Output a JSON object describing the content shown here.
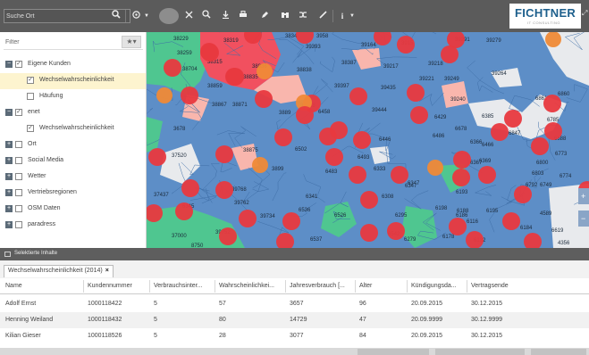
{
  "toolbar": {
    "search_placeholder": "Suche Ort",
    "buttons": [
      "search-icon",
      "globe-icon",
      "caret-icon",
      "fullscreen-icon",
      "zoom-icon",
      "download-icon",
      "print-icon",
      "pencil-icon",
      "binoculars-icon",
      "shuffle-icon",
      "ruler-icon",
      "info-icon"
    ],
    "logo": "FICHTNER",
    "logo_sub": "IT CONSULTING"
  },
  "panel": {
    "filter_placeholder": "Filter",
    "items": [
      {
        "label": "Eigene Kunden",
        "expanded": true,
        "checked": true,
        "level": 0
      },
      {
        "label": "Wechselwahrscheinlichkeit",
        "checked": true,
        "level": 1,
        "selected": true
      },
      {
        "label": "Häufung",
        "checked": false,
        "level": 1
      },
      {
        "label": "enet",
        "expanded": true,
        "checked": true,
        "level": 0
      },
      {
        "label": "Wechselwahrscheinlichkeit",
        "checked": true,
        "level": 1
      },
      {
        "label": "Ort",
        "checked": false,
        "level": 0
      },
      {
        "label": "Social Media",
        "checked": false,
        "level": 0
      },
      {
        "label": "Wetter",
        "checked": false,
        "level": 0
      },
      {
        "label": "Vertriebsregionen",
        "checked": false,
        "level": 0
      },
      {
        "label": "OSM Daten",
        "checked": false,
        "level": 0
      },
      {
        "label": "paradress",
        "checked": false,
        "level": 0
      }
    ]
  },
  "map": {
    "colors": {
      "land": "#5d8ec7",
      "water": "#e8eaed",
      "green": "#4fc690",
      "red_region": "#f1505f",
      "pink": "#f9b6ad",
      "marker_red": "#e8393f",
      "marker_orange": "#ef8a37"
    },
    "postcodes": [
      "38229",
      "38319",
      "3834",
      "3958",
      "39291",
      "38259",
      "39393",
      "39164",
      "3915",
      "39279",
      "38315",
      "38704",
      "38836",
      "38838",
      "38387",
      "39217",
      "39218",
      "38835",
      "39221",
      "39249",
      "39264",
      "38855",
      "38859",
      "39397",
      "39435",
      "38867",
      "38871",
      "3889",
      "38828",
      "6458",
      "39444",
      "39240",
      "6861",
      "6860",
      "6785",
      "3678",
      "6429",
      "6385",
      "6847",
      "6678",
      "6888",
      "6466",
      "6486",
      "6446",
      "6366",
      "6367",
      "37520",
      "38875",
      "6502",
      "6483",
      "6333",
      "6347",
      "6369",
      "6773",
      "6800",
      "6803",
      "6774",
      "3899",
      "6493",
      "6308",
      "6347",
      "6193",
      "6792",
      "6749",
      "37437",
      "39768",
      "6341",
      "39762",
      "6188",
      "4589",
      "6536",
      "6526",
      "6295",
      "6186",
      "6198",
      "6116",
      "6184",
      "6619",
      "39734",
      "6345",
      "6542",
      "6279",
      "6178",
      "6132",
      "4356",
      "6537",
      "39752",
      "8750",
      "37000",
      "6195"
    ]
  },
  "bottom": {
    "panel_title": "Selektierte Inhalte",
    "tab_label": "Wechselwahrscheinlichkeit (2014)",
    "tab_close": "×",
    "columns": [
      "Name",
      "Kundennummer",
      "Verbrauchsinter...",
      "Wahrscheinlichkei...",
      "Jahresverbrauch [...",
      "Alter",
      "Kündigungsda...",
      "Vertragsende"
    ],
    "rows": [
      [
        "Adolf Ernst",
        "1000118422",
        "5",
        "57",
        "3657",
        "96",
        "20.09.2015",
        "30.12.2015"
      ],
      [
        "Henning Weiland",
        "1000118432",
        "5",
        "80",
        "14729",
        "47",
        "20.09.9999",
        "30.12.9999"
      ],
      [
        "Kilian Gieser",
        "1000118526",
        "5",
        "28",
        "3077",
        "84",
        "20.09.2015",
        "30.12.2015"
      ]
    ]
  }
}
